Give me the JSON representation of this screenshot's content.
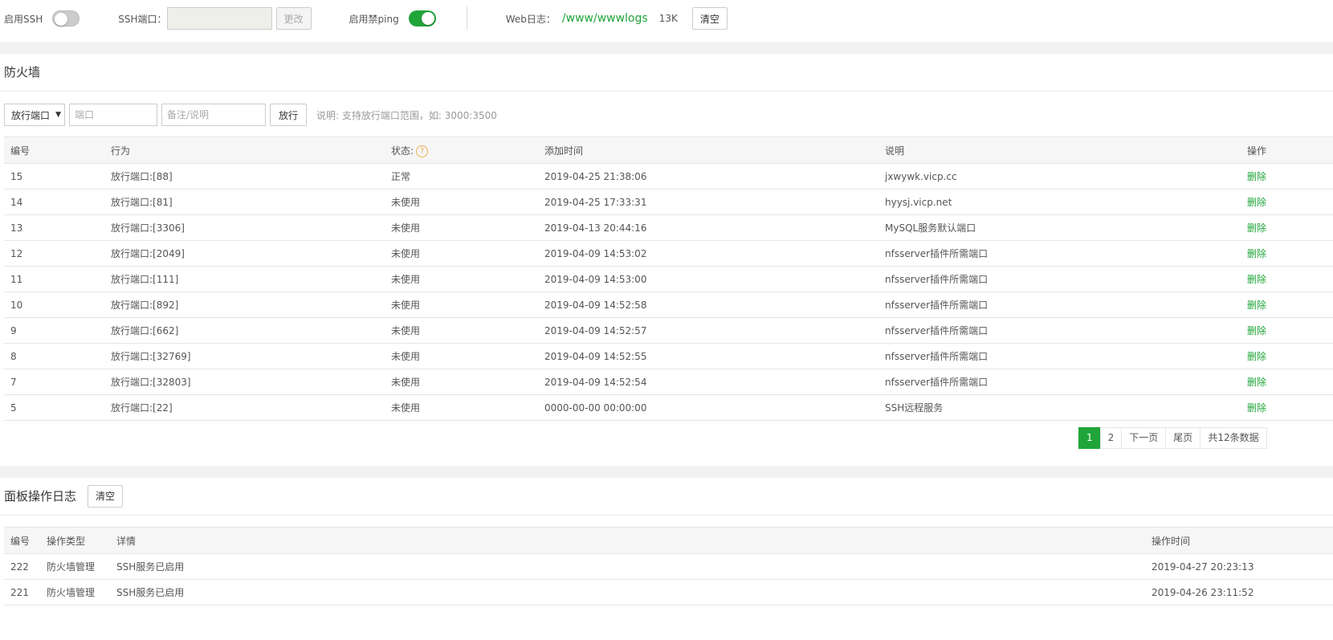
{
  "top": {
    "ssh_label": "启用SSH",
    "ssh_enabled": false,
    "ssh_port_label": "SSH端口：",
    "ssh_port_value": "",
    "change_button": "更改",
    "ping_label": "启用禁ping",
    "ping_enabled": true,
    "weblog_label": "Web日志：",
    "weblog_path": "/www/wwwlogs",
    "weblog_size": "13K",
    "clear_button": "清空"
  },
  "firewall": {
    "title": "防火墙",
    "select_value": "放行端口",
    "port_placeholder": "端口",
    "note_placeholder": "备注/说明",
    "allow_button": "放行",
    "hint": "说明: 支持放行端口范围，如: 3000:3500",
    "columns": [
      "编号",
      "行为",
      "状态:",
      "添加时间",
      "说明",
      "操作"
    ],
    "rows": [
      {
        "id": "15",
        "action": "放行端口:[88]",
        "status": "正常",
        "time": "2019-04-25 21:38:06",
        "note": "jxwywk.vicp.cc",
        "op": "删除"
      },
      {
        "id": "14",
        "action": "放行端口:[81]",
        "status": "未使用",
        "time": "2019-04-25 17:33:31",
        "note": "hyysj.vicp.net",
        "op": "删除"
      },
      {
        "id": "13",
        "action": "放行端口:[3306]",
        "status": "未使用",
        "time": "2019-04-13 20:44:16",
        "note": "MySQL服务默认端口",
        "op": "删除"
      },
      {
        "id": "12",
        "action": "放行端口:[2049]",
        "status": "未使用",
        "time": "2019-04-09 14:53:02",
        "note": "nfsserver插件所需端口",
        "op": "删除"
      },
      {
        "id": "11",
        "action": "放行端口:[111]",
        "status": "未使用",
        "time": "2019-04-09 14:53:00",
        "note": "nfsserver插件所需端口",
        "op": "删除"
      },
      {
        "id": "10",
        "action": "放行端口:[892]",
        "status": "未使用",
        "time": "2019-04-09 14:52:58",
        "note": "nfsserver插件所需端口",
        "op": "删除"
      },
      {
        "id": "9",
        "action": "放行端口:[662]",
        "status": "未使用",
        "time": "2019-04-09 14:52:57",
        "note": "nfsserver插件所需端口",
        "op": "删除"
      },
      {
        "id": "8",
        "action": "放行端口:[32769]",
        "status": "未使用",
        "time": "2019-04-09 14:52:55",
        "note": "nfsserver插件所需端口",
        "op": "删除"
      },
      {
        "id": "7",
        "action": "放行端口:[32803]",
        "status": "未使用",
        "time": "2019-04-09 14:52:54",
        "note": "nfsserver插件所需端口",
        "op": "删除"
      },
      {
        "id": "5",
        "action": "放行端口:[22]",
        "status": "未使用",
        "time": "0000-00-00 00:00:00",
        "note": "SSH远程服务",
        "op": "删除"
      }
    ],
    "pager": {
      "page1": "1",
      "page2": "2",
      "next": "下一页",
      "last": "尾页",
      "total": "共12条数据"
    }
  },
  "oplog": {
    "title": "面板操作日志",
    "clear_button": "清空",
    "columns": [
      "编号",
      "操作类型",
      "详情",
      "操作时间"
    ],
    "rows": [
      {
        "id": "222",
        "type": "防火墙管理",
        "detail": "SSH服务已启用",
        "time": "2019-04-27 20:23:13"
      },
      {
        "id": "221",
        "type": "防火墙管理",
        "detail": "SSH服务已启用",
        "time": "2019-04-26 23:11:52"
      }
    ]
  },
  "colors": {
    "accent": "#20a53a",
    "warn": "#f0ad4e"
  }
}
